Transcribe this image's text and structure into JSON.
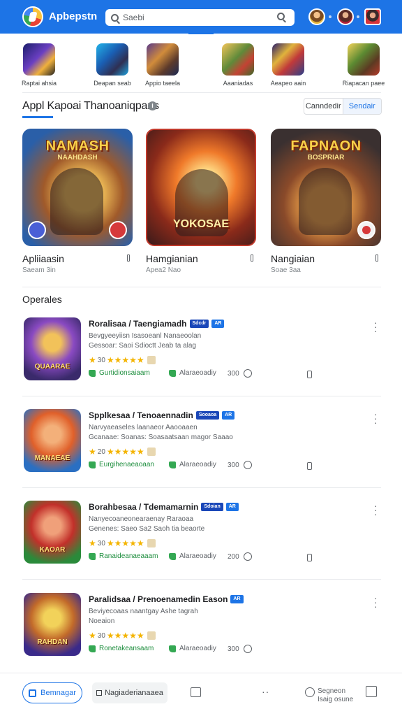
{
  "header": {
    "brand": "Apbepstn",
    "search_placeholder": "Saebi",
    "colors": {
      "bar": "#1d74e6",
      "accent": "#1d74e6"
    }
  },
  "icon_row": [
    {
      "label": "Raptai ahsia",
      "icon": "game-icon"
    },
    {
      "label": "Deapan seab",
      "icon": "game-icon"
    },
    {
      "label": "Appio taeela",
      "icon": "game-icon"
    },
    {
      "label": "Aaaniadas",
      "icon": "game-icon"
    },
    {
      "label": "Aeapeo aain",
      "icon": "game-icon"
    },
    {
      "label": "Riapacan paee",
      "icon": "game-icon"
    }
  ],
  "section": {
    "title": "Appl Kapoai Thanoaniqpans",
    "seg_left": "Canndedir",
    "seg_right": "Sendair"
  },
  "featured": [
    {
      "art_title": "NAMASH",
      "art_subtitle": "NAAHDASH",
      "name": "Apliiaasin",
      "meta": "Saeam 3in"
    },
    {
      "art_title": "",
      "art_subtitle": "YOKOSAE",
      "name": "Hamgianian",
      "meta": "Apea2 Nao"
    },
    {
      "art_title": "FAPNAON",
      "art_subtitle": "BOSPRIAR",
      "name": "Nangiaian",
      "meta": "Soae 3aa"
    }
  ],
  "list_title": "Operales",
  "list": [
    {
      "title": "Roralisaa / Taengiamadh",
      "pills": [
        "Sdcdr",
        "AR"
      ],
      "desc1": "Bevgyeeyiisn Isasoeanl Nanaeoolan",
      "desc2": "Gessoar: Saoi Sdioctt Jeab ta alag",
      "rating": "30",
      "action1": "Gurtidionsaiaam",
      "action2": "Alaraeoadiy",
      "action3": "300",
      "thumb_label": "QUAARAE"
    },
    {
      "title": "Spplkesaa / Tenoaennadin",
      "pills": [
        "Sooaoa",
        "AR"
      ],
      "desc1": "Narvyaeaseles laanaeor Aaooaaen",
      "desc2": "Gcanaae: Soanas: Soasaatsaan magor Saaao",
      "rating": "20",
      "action1": "Eurgihenaeaoaan",
      "action2": "Alaraeoadiy",
      "action3": "300",
      "thumb_label": "MANAEAE"
    },
    {
      "title": "Borahbesaa / Tdemamarnin",
      "pills": [
        "Sdoian",
        "AR"
      ],
      "desc1": "Nanyecoaneonearaenay Raraoaa",
      "desc2": "Genenes: Saeo Sa2 Saoh tia beaorte",
      "rating": "30",
      "action1": "Ranaideanaeaaam",
      "action2": "Alaraeoadiy",
      "action3": "200",
      "thumb_label": "KAOAR"
    },
    {
      "title": "Paralidsaa / Prenoenamedin Eason",
      "pills": [
        "AR"
      ],
      "desc1": "Beviyecoaas naantgay Ashe tagrah",
      "desc2": "Noeaion",
      "rating": "30",
      "action1": "Ronetakeansaam",
      "action2": "Alaraeoadiy",
      "action3": "300",
      "thumb_label": "RAHDAN"
    }
  ],
  "bottom": {
    "home_label": "Bemnagar",
    "nav_label": "Nagiaderianaaea",
    "updates_line1": "Segneon",
    "updates_line2": "Isaig osune"
  }
}
